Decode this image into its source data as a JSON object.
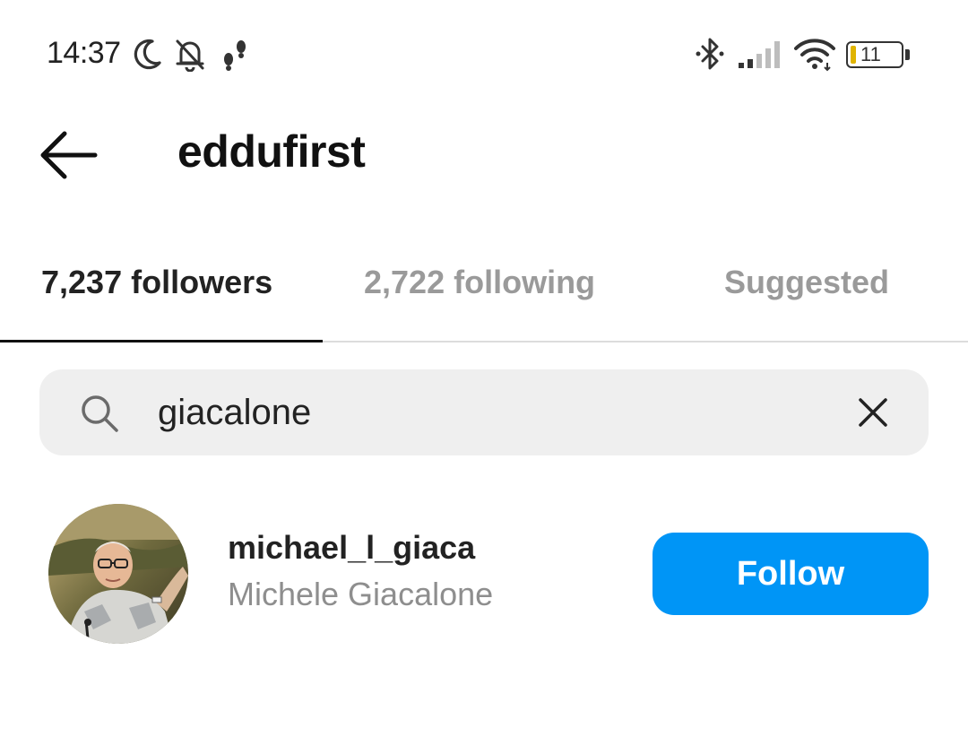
{
  "status_bar": {
    "time": "14:37",
    "battery": "11",
    "icons": [
      "moon-icon",
      "bell-off-icon",
      "steps-icon",
      "bluetooth-icon",
      "signal-icon",
      "wifi-icon",
      "battery-icon"
    ]
  },
  "header": {
    "title": "eddufirst",
    "back_icon": "arrow-left-icon"
  },
  "tabs": [
    {
      "label": "7,237 followers",
      "active": true
    },
    {
      "label": "2,722 following",
      "active": false
    },
    {
      "label": "Suggested",
      "active": false
    }
  ],
  "search": {
    "value": "giacalone",
    "icon": "search-icon",
    "clear_icon": "close-icon"
  },
  "results": [
    {
      "username": "michael_l_giaca",
      "full_name": "Michele Giacalone",
      "button_label": "Follow"
    }
  ],
  "colors": {
    "accent": "#0095f6",
    "search_bg": "#efefef",
    "muted_text": "#8e8e8e",
    "inactive_tab": "#9a9a9a"
  }
}
